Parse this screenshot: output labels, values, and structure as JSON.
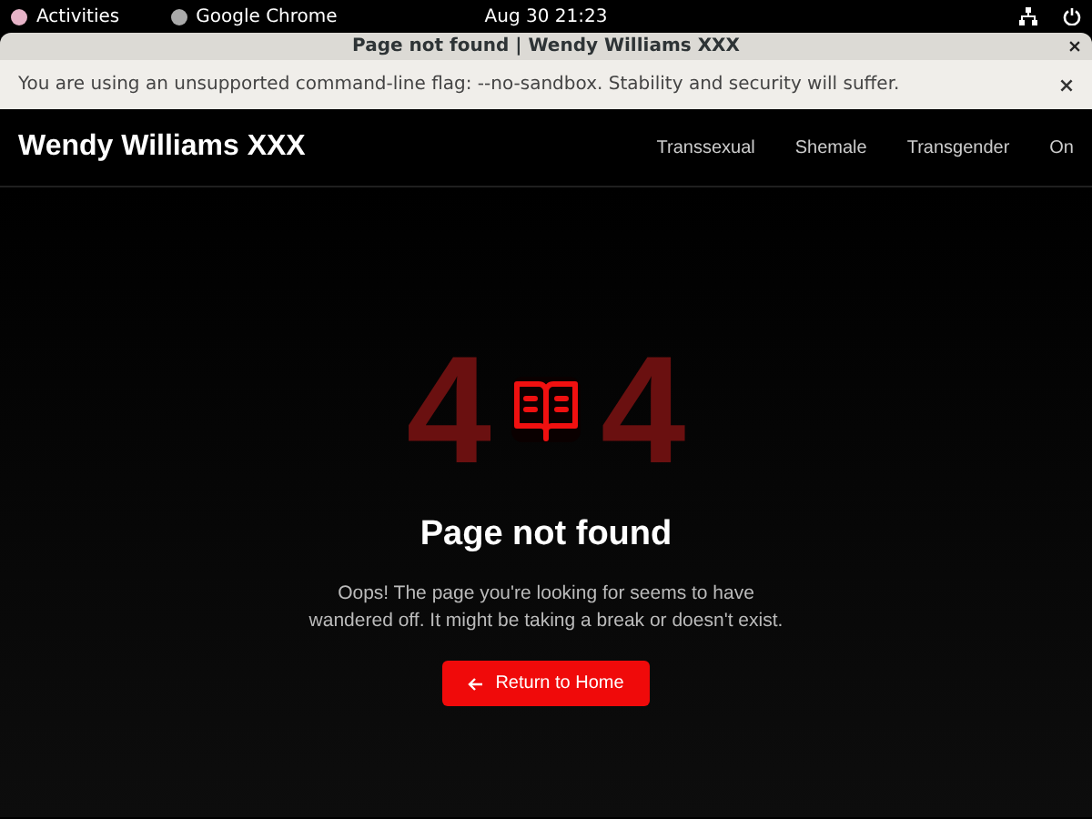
{
  "top_bar": {
    "activities": "Activities",
    "app": "Google Chrome",
    "clock": "Aug 30  21:23"
  },
  "window": {
    "title": "Page not found | Wendy Williams XXX"
  },
  "infobar": {
    "message": "You are using an unsupported command-line flag: --no-sandbox. Stability and security will suffer."
  },
  "site_header": {
    "brand": "Wendy Williams XXX",
    "nav": [
      "Transsexual",
      "Shemale",
      "Transgender",
      "On"
    ]
  },
  "error": {
    "code_digits": [
      "4",
      "4"
    ],
    "heading": "Page not found",
    "message": "Oops! The page you're looking for seems to have wandered off. It might be taking a break or doesn't exist.",
    "button": "Return to Home"
  }
}
